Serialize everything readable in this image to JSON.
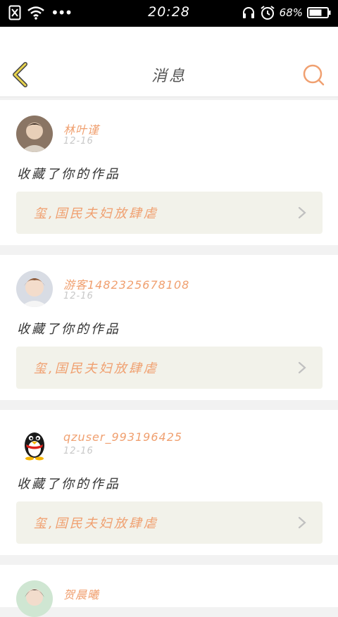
{
  "status_bar": {
    "time": "20:28",
    "battery": "68%",
    "icons": [
      "sim-off-icon",
      "wifi-icon",
      "more-dots-icon",
      "headset-icon",
      "alarm-icon",
      "battery-icon"
    ]
  },
  "header": {
    "title": "消息",
    "back_icon": "back-chevron-icon",
    "search_icon": "search-icon",
    "colors": {
      "back": "#e8d44d",
      "search": "#f0a070"
    }
  },
  "messages": [
    {
      "username": "林叶谨",
      "date": "12-16",
      "action": "收藏了你的作品",
      "work": "玺,国民夫妇放肆虐"
    },
    {
      "username": "游客1482325678108",
      "date": "12-16",
      "action": "收藏了你的作品",
      "work": "玺,国民夫妇放肆虐"
    },
    {
      "username": "qzuser_993196425",
      "date": "12-16",
      "action": "收藏了你的作品",
      "work": "玺,国民夫妇放肆虐"
    },
    {
      "username": "贺晨曦"
    }
  ],
  "colors": {
    "accent": "#f0a070",
    "link_bg": "#f2f2ea",
    "date": "#c8c8c8"
  }
}
